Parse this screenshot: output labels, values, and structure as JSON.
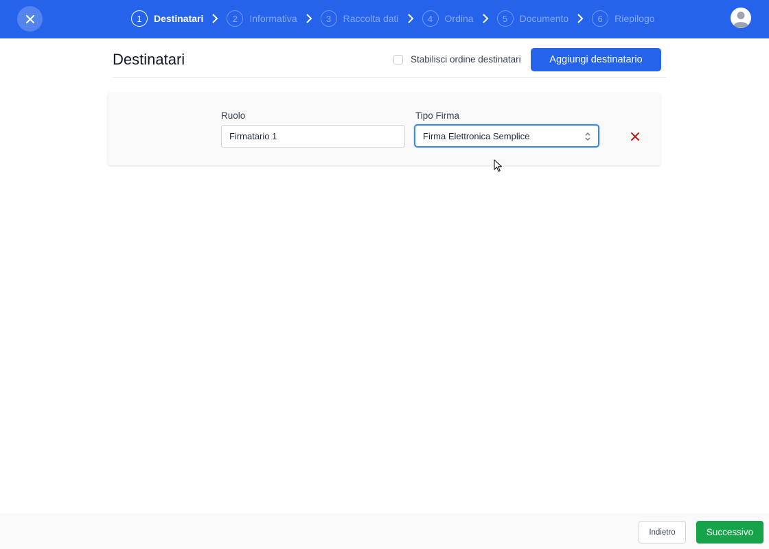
{
  "header": {
    "steps": [
      {
        "number": "1",
        "label": "Destinatari",
        "active": true
      },
      {
        "number": "2",
        "label": "Informativa",
        "active": false
      },
      {
        "number": "3",
        "label": "Raccolta dati",
        "active": false
      },
      {
        "number": "4",
        "label": "Ordina",
        "active": false
      },
      {
        "number": "5",
        "label": "Documento",
        "active": false
      },
      {
        "number": "6",
        "label": "Riepilogo",
        "active": false
      }
    ],
    "close_icon": "close-icon",
    "step_separator_icon": "chevron-right-icon",
    "avatar_icon": "user-avatar-icon"
  },
  "main": {
    "title": "Destinatari",
    "order_checkbox": {
      "label": "Stabilisci ordine destinatari",
      "checked": false
    },
    "add_button": "Aggiungi destinatario"
  },
  "recipient": {
    "role_label": "Ruolo",
    "role_value": "Firmatario 1",
    "signature_label": "Tipo Firma",
    "signature_value": "Firma Elettronica Semplice",
    "remove_icon": "close-icon"
  },
  "footer": {
    "back_label": "Indietro",
    "next_label": "Successivo"
  },
  "colors": {
    "primary": "#2563eb",
    "success": "#16a34a",
    "danger": "#b91c1c"
  }
}
